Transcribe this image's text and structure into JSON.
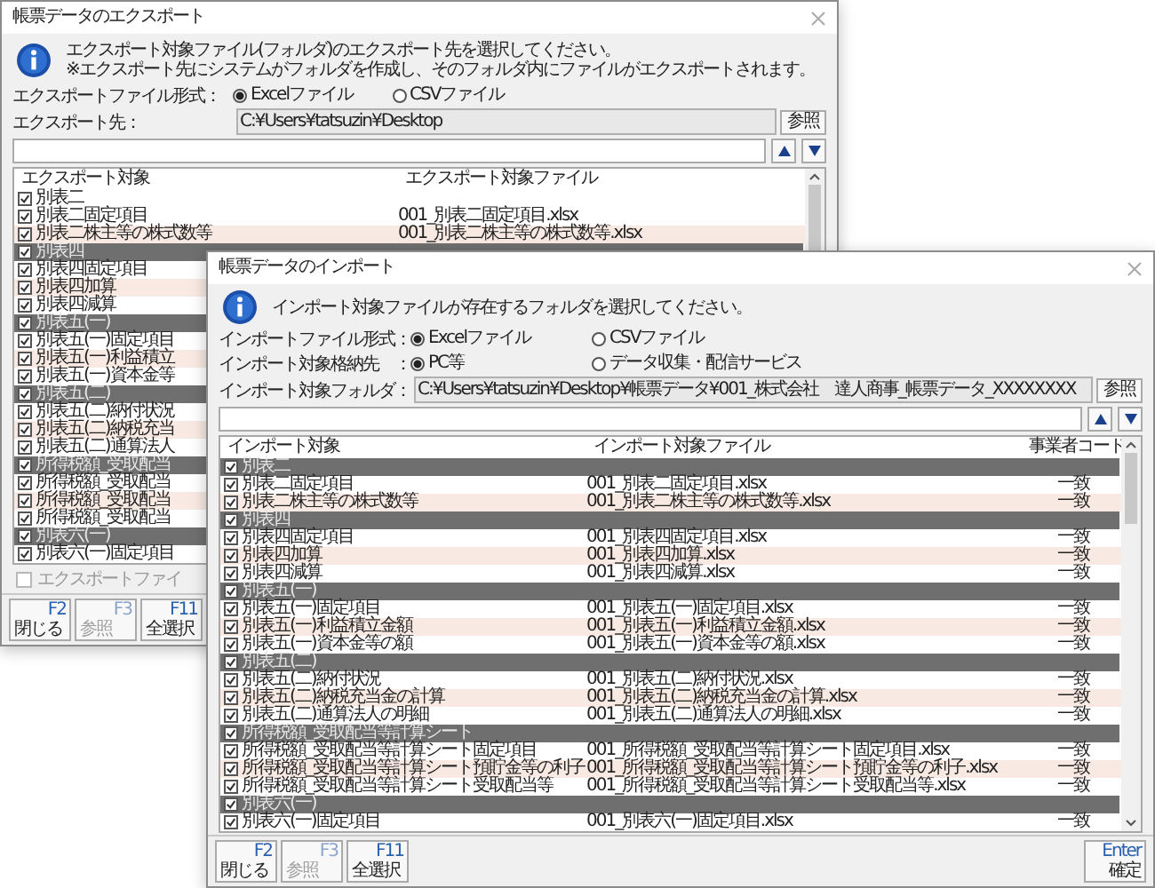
{
  "windows": [
    {
      "title": "帳票データのエクスポート",
      "message": [
        "エクスポート対象ファイル(フォルダ)のエクスポート先を選択してください。",
        "※エクスポート先にシステムがフォルダを作成し、そのフォルダ内にファイルがエクスポートされます。"
      ],
      "option_rows": [
        {
          "label": "エクスポートファイル形式：",
          "options": [
            {
              "label": "Excelファイル",
              "selected": true
            },
            {
              "label": "CSVファイル",
              "selected": false
            }
          ]
        }
      ],
      "folder": {
        "label": "エクスポート先：",
        "value": "C:¥Users¥tatsuzin¥Desktop",
        "button": "参照"
      },
      "list": {
        "columns": [
          "エクスポート対象",
          "エクスポート対象ファイル"
        ],
        "groups": [
          {
            "label": "別表二",
            "checked": true,
            "selected": true,
            "items": [
              {
                "label": "別表二固定項目",
                "file": "001_別表二固定項目.xlsx",
                "checked": true
              },
              {
                "label": "別表二株主等の株式数等",
                "file": "001_別表二株主等の株式数等.xlsx",
                "checked": true
              }
            ]
          },
          {
            "label": "別表四",
            "checked": true,
            "selected": false,
            "items": [
              {
                "label": "別表四固定項目",
                "checked": true
              },
              {
                "label": "別表四加算",
                "checked": true
              },
              {
                "label": "別表四減算",
                "checked": true
              }
            ]
          },
          {
            "label": "別表五(一)",
            "checked": true,
            "selected": false,
            "items": [
              {
                "label": "別表五(一)固定項目",
                "checked": true
              },
              {
                "label": "別表五(一)利益積立",
                "checked": true
              },
              {
                "label": "別表五(一)資本金等",
                "checked": true
              }
            ]
          },
          {
            "label": "別表五(二)",
            "checked": true,
            "selected": false,
            "items": [
              {
                "label": "別表五(二)納付状況",
                "checked": true
              },
              {
                "label": "別表五(二)納税充当",
                "checked": true
              },
              {
                "label": "別表五(二)通算法人",
                "checked": true
              }
            ]
          },
          {
            "label": "所得税額_受取配当",
            "checked": true,
            "selected": false,
            "items": [
              {
                "label": "所得税額_受取配当",
                "checked": true
              },
              {
                "label": "所得税額_受取配当",
                "checked": true
              },
              {
                "label": "所得税額_受取配当",
                "checked": true
              }
            ]
          },
          {
            "label": "別表六(一)",
            "checked": true,
            "selected": false,
            "items": [
              {
                "label": "別表六(一)固定項目",
                "checked": true
              }
            ]
          }
        ]
      },
      "checkbox": {
        "label": "エクスポートファイ",
        "checked": false,
        "disabled": true
      },
      "buttons": [
        {
          "key": "F2",
          "label": "閉じる",
          "disabled": false
        },
        {
          "key": "F3",
          "label": "参照",
          "disabled": true
        },
        {
          "key": "F11",
          "label": "全選択",
          "disabled": false
        }
      ]
    },
    {
      "title": "帳票データのインポート",
      "message": [
        "インポート対象ファイルが存在するフォルダを選択してください。"
      ],
      "option_rows": [
        {
          "label": "インポートファイル形式：",
          "options": [
            {
              "label": "Excelファイル",
              "selected": true
            },
            {
              "label": "CSVファイル",
              "selected": false
            }
          ]
        },
        {
          "label": "インポート対象格納先　：",
          "options": [
            {
              "label": "PC等",
              "selected": true
            },
            {
              "label": "データ収集・配信サービス",
              "selected": false
            }
          ]
        }
      ],
      "folder": {
        "label": "インポート対象フォルダ：",
        "value": "C:¥Users¥tatsuzin¥Desktop¥帳票データ¥001_株式会社　達人商事_帳票データ_XXXXXXXX",
        "button": "参照"
      },
      "list": {
        "columns": [
          "インポート対象",
          "インポート対象ファイル",
          "事業者コード"
        ],
        "groups": [
          {
            "label": "別表二",
            "checked": true,
            "selected": false,
            "items": [
              {
                "label": "別表二固定項目",
                "file": "001_別表二固定項目.xlsx",
                "code": "一致",
                "checked": true
              },
              {
                "label": "別表二株主等の株式数等",
                "file": "001_別表二株主等の株式数等.xlsx",
                "code": "一致",
                "checked": true
              }
            ]
          },
          {
            "label": "別表四",
            "checked": true,
            "selected": false,
            "items": [
              {
                "label": "別表四固定項目",
                "file": "001_別表四固定項目.xlsx",
                "code": "一致",
                "checked": true
              },
              {
                "label": "別表四加算",
                "file": "001_別表四加算.xlsx",
                "code": "一致",
                "checked": true
              },
              {
                "label": "別表四減算",
                "file": "001_別表四減算.xlsx",
                "code": "一致",
                "checked": true
              }
            ]
          },
          {
            "label": "別表五(一)",
            "checked": true,
            "selected": false,
            "items": [
              {
                "label": "別表五(一)固定項目",
                "file": "001_別表五(一)固定項目.xlsx",
                "code": "一致",
                "checked": true
              },
              {
                "label": "別表五(一)利益積立金額",
                "file": "001_別表五(一)利益積立金額.xlsx",
                "code": "一致",
                "checked": true
              },
              {
                "label": "別表五(一)資本金等の額",
                "file": "001_別表五(一)資本金等の額.xlsx",
                "code": "一致",
                "checked": true
              }
            ]
          },
          {
            "label": "別表五(二)",
            "checked": true,
            "selected": false,
            "items": [
              {
                "label": "別表五(二)納付状況",
                "file": "001_別表五(二)納付状況.xlsx",
                "code": "一致",
                "checked": true
              },
              {
                "label": "別表五(二)納税充当金の計算",
                "file": "001_別表五(二)納税充当金の計算.xlsx",
                "code": "一致",
                "checked": true
              },
              {
                "label": "別表五(二)通算法人の明細",
                "file": "001_別表五(二)通算法人の明細.xlsx",
                "code": "一致",
                "checked": true
              }
            ]
          },
          {
            "label": "所得税額_受取配当等計算シート",
            "checked": true,
            "selected": false,
            "items": [
              {
                "label": "所得税額_受取配当等計算シート固定項目",
                "file": "001_所得税額_受取配当等計算シート固定項目.xlsx",
                "code": "一致",
                "checked": true
              },
              {
                "label": "所得税額_受取配当等計算シート預貯金等の利子",
                "file": "001_所得税額_受取配当等計算シート預貯金等の利子.xlsx",
                "code": "一致",
                "checked": true
              },
              {
                "label": "所得税額_受取配当等計算シート受取配当等",
                "file": "001_所得税額_受取配当等計算シート受取配当等.xlsx",
                "code": "一致",
                "checked": true
              }
            ]
          },
          {
            "label": "別表六(一)",
            "checked": true,
            "selected": false,
            "items": [
              {
                "label": "別表六(一)固定項目",
                "file": "001_別表六(一)固定項目.xlsx",
                "code": "一致",
                "checked": true
              }
            ]
          }
        ]
      },
      "buttons": [
        {
          "key": "F2",
          "label": "閉じる",
          "disabled": false
        },
        {
          "key": "F3",
          "label": "参照",
          "disabled": true
        },
        {
          "key": "F11",
          "label": "全選択",
          "disabled": false
        }
      ],
      "confirm_button": {
        "key": "Enter",
        "label": "確定"
      }
    }
  ]
}
